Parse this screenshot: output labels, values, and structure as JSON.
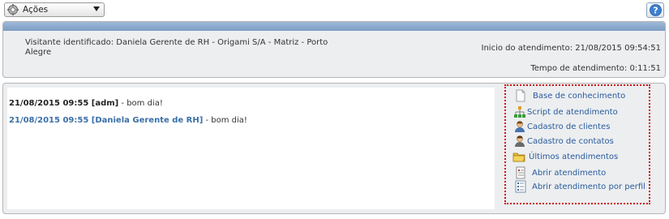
{
  "toolbar": {
    "actions_label": "Ações"
  },
  "info": {
    "visitor": "Visitante identificado: Daniela Gerente de RH - Origami S/A - Matriz - Porto Alegre",
    "inicio": "Inicio do atendimento: 21/08/2015 09:54:51",
    "tempo": "Tempo de atendimento: 0:11:51"
  },
  "chat": {
    "messages": [
      {
        "header": "21/08/2015 09:55 [adm]",
        "separator": " - ",
        "text": "bom dia!"
      },
      {
        "header": "21/08/2015 09:55 [Daniela Gerente de RH]",
        "separator": " - ",
        "text": "bom dia!"
      }
    ]
  },
  "links": [
    {
      "label": "Base de conhecimento",
      "icon": "document-icon"
    },
    {
      "label": "Script de atendimento",
      "icon": "hierarchy-icon"
    },
    {
      "label": "Cadastro de clientes",
      "icon": "user-icon"
    },
    {
      "label": "Cadastro de contatos",
      "icon": "contact-icon"
    },
    {
      "label": "Últimos atendimentos",
      "icon": "folder-icon"
    },
    {
      "label": "Abrir atendimento",
      "icon": "form-icon"
    },
    {
      "label": "Abrir atendimento por perfil",
      "icon": "list-form-icon"
    }
  ],
  "colors": {
    "header_band": "#8aa9cf",
    "link": "#2a5b9c",
    "chat_user": "#3a6fa8",
    "highlight_border": "#cc1111"
  }
}
